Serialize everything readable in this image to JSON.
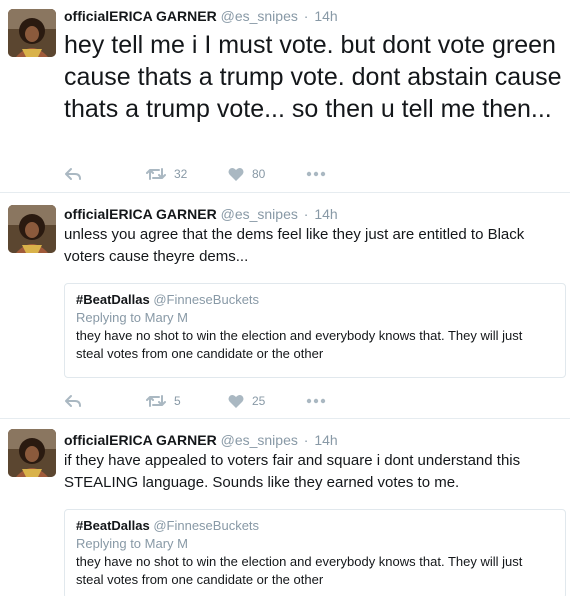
{
  "tweets": [
    {
      "author_name": "officialERICA GARNER",
      "author_handle": "@es_snipes",
      "separator": "·",
      "time": "14h",
      "text": "hey tell me i I must vote. but dont vote green cause thats a trump vote. dont abstain cause thats a trump vote... so then u tell me then...",
      "retweets": "32",
      "likes": "80"
    },
    {
      "author_name": "officialERICA GARNER",
      "author_handle": "@es_snipes",
      "separator": "·",
      "time": "14h",
      "text": "unless you agree that the dems feel like they just are entitled to Black voters cause theyre dems...",
      "quote": {
        "name": "#BeatDallas",
        "handle": "@FinneseBuckets",
        "replying": "Replying to Mary M",
        "text": "they have no shot to win the election and everybody knows that. They will just steal votes from one candidate or the other"
      },
      "retweets": "5",
      "likes": "25"
    },
    {
      "author_name": "officialERICA GARNER",
      "author_handle": "@es_snipes",
      "separator": "·",
      "time": "14h",
      "text": "if they have appealed to voters fair and square i dont understand this STEALING language. Sounds like they earned votes to me.",
      "quote": {
        "name": "#BeatDallas",
        "handle": "@FinneseBuckets",
        "replying": "Replying to Mary M",
        "text": "they have no shot to win the election and everybody knows that. They will just steal votes from one candidate or the other"
      }
    }
  ],
  "icons": {
    "reply": "reply-icon",
    "retweet": "retweet-icon",
    "like": "heart-icon",
    "more": "more-icon"
  },
  "colors": {
    "text": "#14171a",
    "secondary": "#8899a6",
    "border": "#e6ecf0",
    "icon": "#aab8c2"
  }
}
